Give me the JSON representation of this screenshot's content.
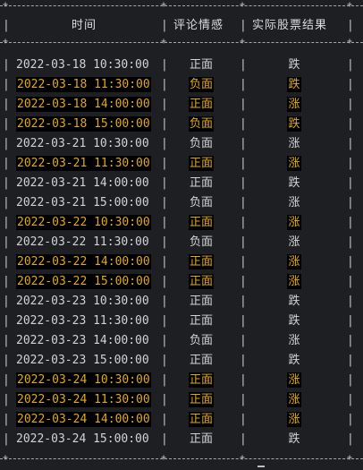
{
  "table": {
    "headers": {
      "time": "时间",
      "sentiment": "评论情感",
      "result": "实际股票结果"
    },
    "rows": [
      {
        "time": "2022-03-18 10:30:00",
        "sentiment": "正面",
        "result": "跌",
        "highlight": false
      },
      {
        "time": "2022-03-18 11:30:00",
        "sentiment": "负面",
        "result": "跌",
        "highlight": true
      },
      {
        "time": "2022-03-18 14:00:00",
        "sentiment": "正面",
        "result": "涨",
        "highlight": true
      },
      {
        "time": "2022-03-18 15:00:00",
        "sentiment": "负面",
        "result": "跌",
        "highlight": true
      },
      {
        "time": "2022-03-21 10:30:00",
        "sentiment": "负面",
        "result": "涨",
        "highlight": false
      },
      {
        "time": "2022-03-21 11:30:00",
        "sentiment": "正面",
        "result": "涨",
        "highlight": true
      },
      {
        "time": "2022-03-21 14:00:00",
        "sentiment": "正面",
        "result": "跌",
        "highlight": false
      },
      {
        "time": "2022-03-21 15:00:00",
        "sentiment": "负面",
        "result": "涨",
        "highlight": false
      },
      {
        "time": "2022-03-22 10:30:00",
        "sentiment": "正面",
        "result": "涨",
        "highlight": true
      },
      {
        "time": "2022-03-22 11:30:00",
        "sentiment": "负面",
        "result": "涨",
        "highlight": false
      },
      {
        "time": "2022-03-22 14:00:00",
        "sentiment": "正面",
        "result": "涨",
        "highlight": true
      },
      {
        "time": "2022-03-22 15:00:00",
        "sentiment": "正面",
        "result": "涨",
        "highlight": true
      },
      {
        "time": "2022-03-23 10:30:00",
        "sentiment": "正面",
        "result": "跌",
        "highlight": false
      },
      {
        "time": "2022-03-23 11:30:00",
        "sentiment": "正面",
        "result": "跌",
        "highlight": false
      },
      {
        "time": "2022-03-23 14:00:00",
        "sentiment": "负面",
        "result": "涨",
        "highlight": false
      },
      {
        "time": "2022-03-23 15:00:00",
        "sentiment": "正面",
        "result": "跌",
        "highlight": false
      },
      {
        "time": "2022-03-24 10:30:00",
        "sentiment": "正面",
        "result": "涨",
        "highlight": true
      },
      {
        "time": "2022-03-24 11:30:00",
        "sentiment": "正面",
        "result": "涨",
        "highlight": true
      },
      {
        "time": "2022-03-24 14:00:00",
        "sentiment": "正面",
        "result": "涨",
        "highlight": true
      },
      {
        "time": "2022-03-24 15:00:00",
        "sentiment": "正面",
        "result": "跌",
        "highlight": false
      }
    ]
  },
  "colors": {
    "background": "#1e1f22",
    "text": "#d3d3d3",
    "highlight_text": "#e0a91a",
    "highlight_bg": "#000000"
  }
}
